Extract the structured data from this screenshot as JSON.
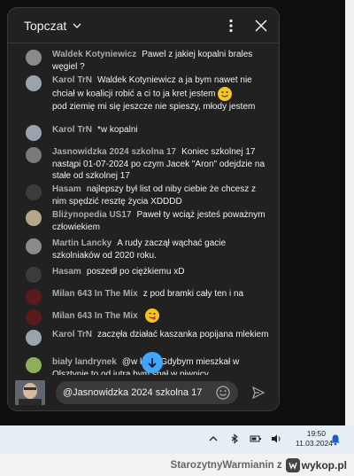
{
  "chat": {
    "title": "Topczat",
    "messages": [
      {
        "author": "Waldek Kotyniewicz",
        "text": "Pawel z jakiej kopalni brales węgiel ?",
        "avatar_color": "#8a8a8a"
      },
      {
        "author": "Karol TrN",
        "text": "Waldek Kotyniewicz a ja bym nawet nie chciał w koalicji robić a ci to ja kret jestem",
        "text2": "pod ziemię mi się jeszcze nie spieszy, młody jestem",
        "emoji": "slightly-smiling-face",
        "avatar_color": "#9aa3b0"
      },
      {
        "author": "Karol TrN",
        "text": "*w kopalni",
        "avatar_color": "#9aa3b0"
      },
      {
        "author": "Jasnowidzka 2024 szkolna 17",
        "text": "Koniec szkolnej 17 nastąpi 01-07-2024 po czym Jacek \"Aron\" odejdzie na stałe od szkolnej 17",
        "avatar_color": "#7a7a7a"
      },
      {
        "author": "Hasam",
        "text": "najlepszy był list od niby ciebie że chcesz z nim spędzić resztę życia XDDDD",
        "avatar_color": "#3b3b3b"
      },
      {
        "author": "Bliżynopedia US17",
        "text": "Paweł ty wciąż jesteś poważnym człowiekiem",
        "avatar_color": "#b7a68a"
      },
      {
        "author": "Martin Lancky",
        "text": "A rudy zaczął wąchać gacie szkolniaków od 2020 roku.",
        "avatar_color": "#8b8b8b"
      },
      {
        "author": "Hasam",
        "text": "poszedł po ciężkiemu xD",
        "avatar_color": "#3b3b3b"
      },
      {
        "author": "Milan 643 In The Mix",
        "text": "z pod bramki cały ten i na",
        "avatar_color": "#5a1a1a"
      },
      {
        "author": "Milan 643 In The Mix",
        "text": "",
        "emoji": "face-savoring-food",
        "avatar_color": "#5a1a1a"
      },
      {
        "author": "Karol TrN",
        "text": "zaczęła działać kaszanka popijana mlekiem",
        "avatar_color": "#9aa3b0"
      },
      {
        "author": "biały landrynek",
        "text": "@w kinie Gdybym mieszkał w Olsztynie to od jutra bym spał w piwnicy",
        "avatar_color": "#8fae5a"
      }
    ],
    "input": {
      "value": "@Jasnowidzka 2024 szkolna 17"
    }
  },
  "taskbar": {
    "time": "19:50",
    "date": "11.03.2024"
  },
  "credit": {
    "user": "StarozytnyWarmianin",
    "prefix": "z",
    "site": "wykop.pl"
  },
  "colors": {
    "panel_bg": "#212121",
    "accent_blue": "#3ea6ff",
    "author_gray": "#aaaaaa",
    "emoji_yellow": "#f6c51e"
  }
}
